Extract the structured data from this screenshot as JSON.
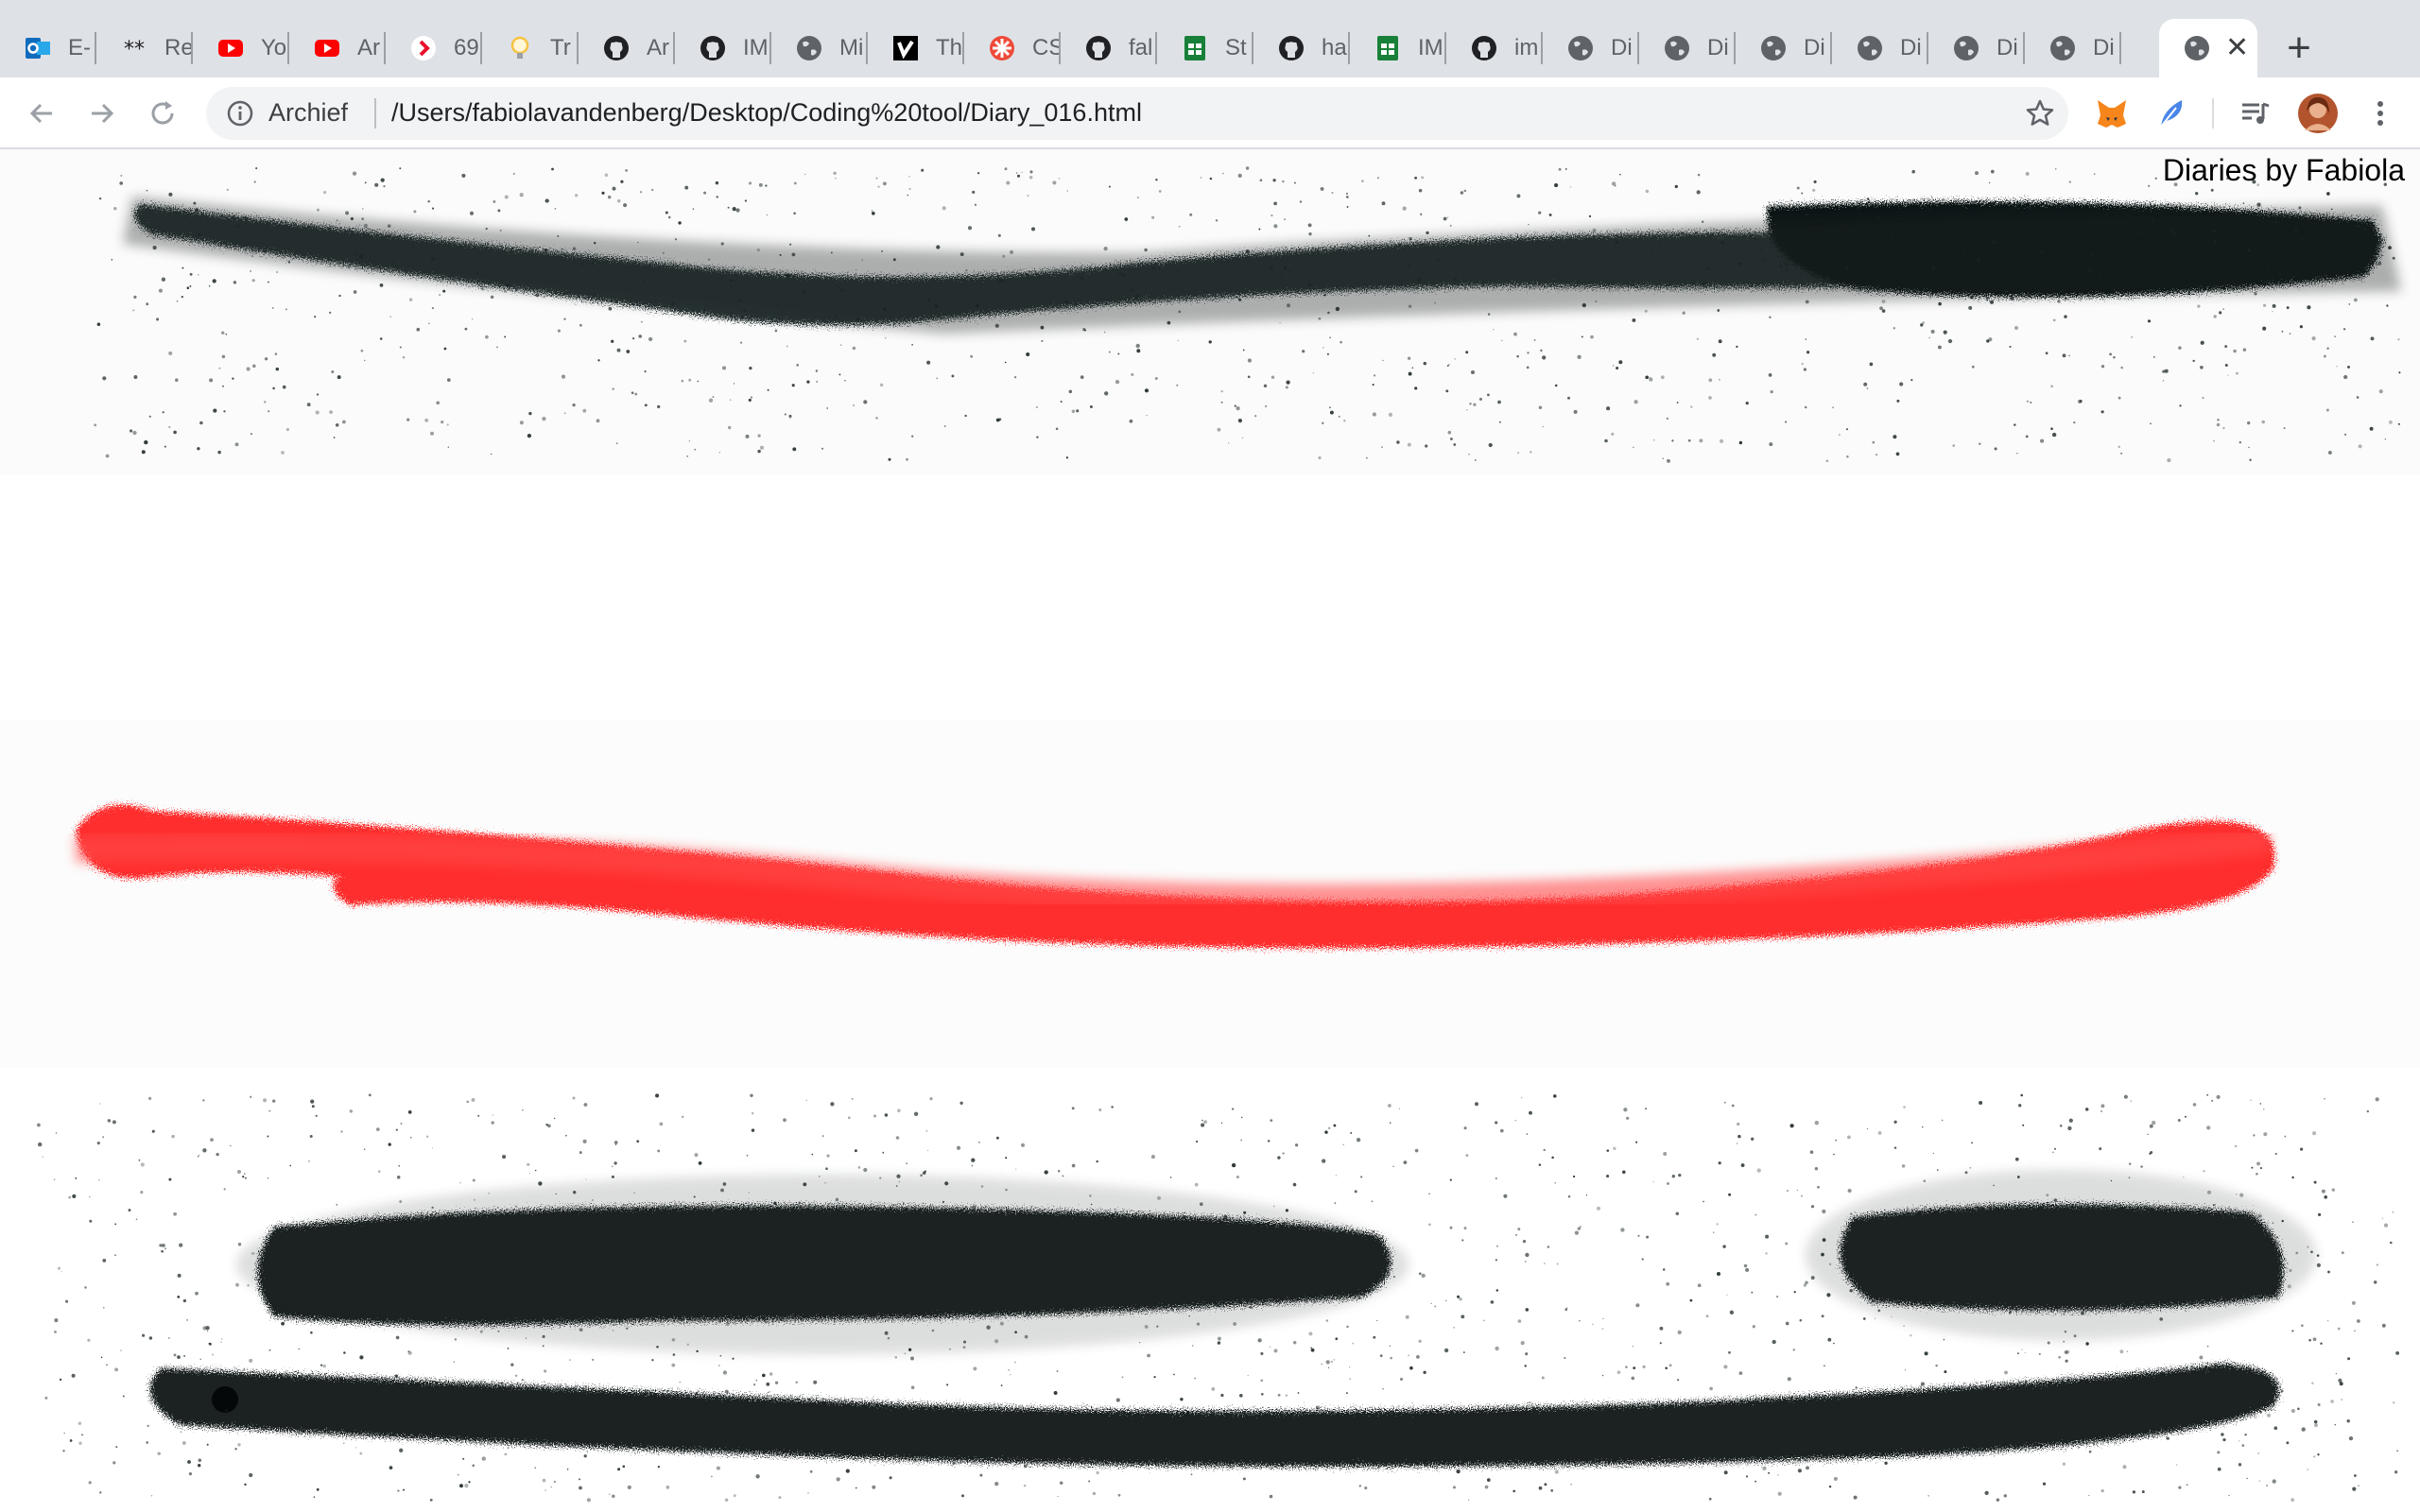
{
  "tabs": [
    {
      "title": "E-",
      "icon": "outlook-icon",
      "color": "#0f6cbd"
    },
    {
      "title": "Re",
      "icon": "asterisk-icon",
      "color": "#202124"
    },
    {
      "title": "Yo",
      "icon": "youtube-icon",
      "color": "#ff0000"
    },
    {
      "title": "Ar",
      "icon": "youtube-icon",
      "color": "#ff0000"
    },
    {
      "title": "69",
      "icon": "chevron-right-icon",
      "color": "#e8112d"
    },
    {
      "title": "Tr",
      "icon": "lightbulb-icon",
      "color": "#f6c343"
    },
    {
      "title": "Ar",
      "icon": "github-icon",
      "color": "#202124"
    },
    {
      "title": "IM",
      "icon": "github-icon",
      "color": "#202124"
    },
    {
      "title": "Mi",
      "icon": "globe-icon",
      "color": "#5f6368"
    },
    {
      "title": "Th",
      "icon": "vimeo-icon",
      "color": "#000000"
    },
    {
      "title": "CS",
      "icon": "flower-icon",
      "color": "#ee4a3a"
    },
    {
      "title": "fal",
      "icon": "github-icon",
      "color": "#202124"
    },
    {
      "title": "St",
      "icon": "sheets-icon",
      "color": "#188038"
    },
    {
      "title": "ha",
      "icon": "github-icon",
      "color": "#202124"
    },
    {
      "title": "IM",
      "icon": "sheets-icon",
      "color": "#188038"
    },
    {
      "title": "im",
      "icon": "github-icon",
      "color": "#202124"
    },
    {
      "title": "Di",
      "icon": "globe-icon",
      "color": "#5f6368"
    },
    {
      "title": "Di",
      "icon": "globe-icon",
      "color": "#5f6368"
    },
    {
      "title": "Di",
      "icon": "globe-icon",
      "color": "#5f6368"
    },
    {
      "title": "Di",
      "icon": "globe-icon",
      "color": "#5f6368"
    },
    {
      "title": "Di",
      "icon": "globe-icon",
      "color": "#5f6368"
    },
    {
      "title": "Di",
      "icon": "globe-icon",
      "color": "#5f6368"
    }
  ],
  "active_tab": {
    "icon": "globe-icon",
    "close": "✕"
  },
  "new_tab": "+",
  "toolbar": {
    "site_chip": "Archief",
    "url": "/Users/fabiolavandenberg/Desktop/Coding%20tool/Diary_016.html"
  },
  "page": {
    "signature": "Diaries by Fabiola",
    "colors": {
      "dark": "#1a2324",
      "red": "#ff2d2d"
    }
  }
}
